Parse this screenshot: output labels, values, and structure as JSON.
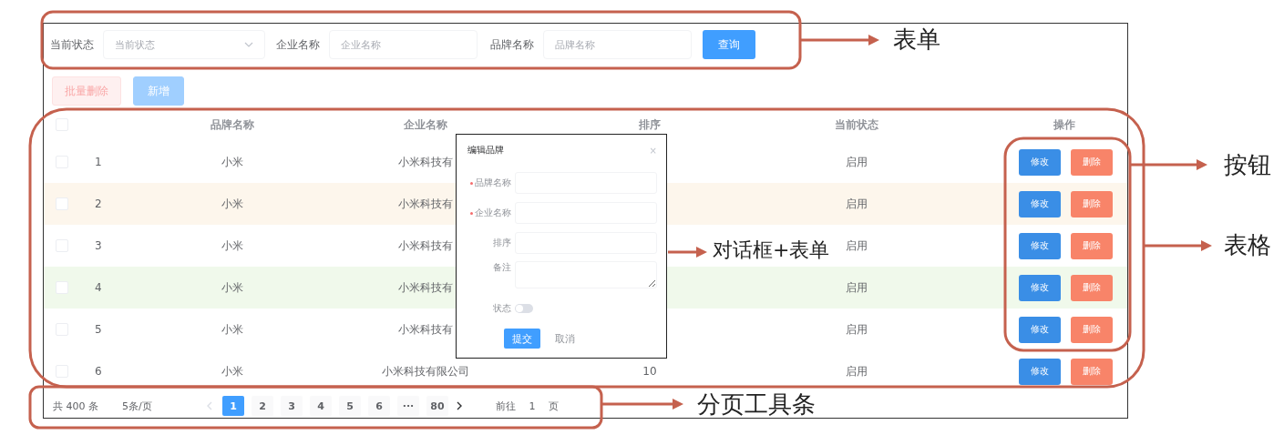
{
  "filter_form": {
    "fields": [
      {
        "label": "当前状态",
        "kind": "select",
        "placeholder": "当前状态"
      },
      {
        "label": "企业名称",
        "kind": "input",
        "placeholder": "企业名称"
      },
      {
        "label": "品牌名称",
        "kind": "input",
        "placeholder": "品牌名称"
      }
    ],
    "submit": "查询"
  },
  "toolbar": [
    {
      "label": "批量删除",
      "kind": "danger",
      "disabled": true
    },
    {
      "label": "新增",
      "kind": "primary",
      "disabled": true
    }
  ],
  "table": {
    "select_all_checked": false,
    "columns": [
      "品牌名称",
      "企业名称",
      "排序",
      "当前状态",
      "操作"
    ],
    "rows": [
      {
        "checked": false,
        "index": "1",
        "brand": "小米",
        "company": "小米科技有",
        "status": "启用",
        "actions": [
          "修改",
          "删除"
        ]
      },
      {
        "checked": false,
        "color": "#fdf6ec",
        "index": "2",
        "brand": "小米",
        "company": "小米科技有",
        "status": "启用",
        "actions": [
          "修改",
          "删除"
        ]
      },
      {
        "checked": false,
        "index": "3",
        "brand": "小米",
        "company": "小米科技有",
        "status": "启用",
        "actions": [
          "修改",
          "删除"
        ]
      },
      {
        "checked": false,
        "color": "#f0f9eb",
        "index": "4",
        "brand": "小米",
        "company": "小米科技有",
        "status": "启用",
        "actions": [
          "修改",
          "删除"
        ]
      },
      {
        "checked": false,
        "index": "5",
        "brand": "小米",
        "company": "小米科技有",
        "status": "启用",
        "actions": [
          "修改",
          "删除"
        ]
      },
      {
        "checked": false,
        "index": "6",
        "brand": "小米",
        "company": "小米科技有限公司",
        "sort": "10",
        "status": "启用",
        "actions": [
          "修改",
          "删除"
        ]
      }
    ]
  },
  "dialog": {
    "title": "编辑品牌",
    "close": "×",
    "fields": [
      {
        "label": "品牌名称",
        "required": true,
        "kind": "input"
      },
      {
        "label": "企业名称",
        "required": true,
        "kind": "input"
      },
      {
        "label": "排序",
        "required": false,
        "kind": "input"
      },
      {
        "label": "备注",
        "required": false,
        "kind": "textarea"
      },
      {
        "label": "状态",
        "required": false,
        "kind": "switch",
        "on": false
      }
    ],
    "buttons": [
      {
        "label": "提交",
        "kind": "primary"
      },
      {
        "label": "取消",
        "kind": "text"
      }
    ]
  },
  "pagination": {
    "total": "共 400 条",
    "page_size": "5条/页",
    "prev_disabled": true,
    "pages": [
      {
        "label": "1",
        "selected": true
      },
      {
        "label": "2",
        "selected": false
      },
      {
        "label": "3",
        "selected": false
      },
      {
        "label": "4",
        "selected": false
      },
      {
        "label": "5",
        "selected": false
      },
      {
        "label": "6",
        "selected": false
      },
      {
        "label": "···",
        "selected": false
      },
      {
        "label": "80",
        "selected": false
      }
    ],
    "jump_label": "前往",
    "jump_value": "1",
    "jump_suffix": "页"
  },
  "annotations": [
    {
      "kind": "form",
      "label": "表单"
    },
    {
      "kind": "buttons",
      "label": "按钮"
    },
    {
      "kind": "dialog",
      "label": "对话框+表单"
    },
    {
      "kind": "table",
      "label": "表格"
    },
    {
      "kind": "pagination",
      "label": "分页工具条"
    }
  ]
}
